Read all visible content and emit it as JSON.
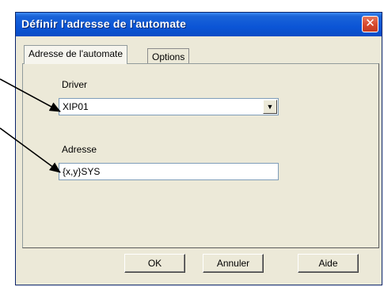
{
  "window": {
    "title": "Définir l'adresse de l'automate",
    "close_symbol": "✕"
  },
  "tabs": [
    {
      "label": "Adresse de l'automate",
      "active": true
    },
    {
      "label": "Options",
      "active": false
    }
  ],
  "form": {
    "driver_label": "Driver",
    "driver_value": "XIP01",
    "dropdown_symbol": "▼",
    "address_label": "Adresse",
    "address_value": "{x,y}SYS"
  },
  "buttons": {
    "ok": "OK",
    "cancel": "Annuler",
    "help": "Aide"
  },
  "colors": {
    "titlebar": "#0b55d6",
    "dialog_bg": "#ece9d8",
    "close_button": "#d6492c"
  }
}
